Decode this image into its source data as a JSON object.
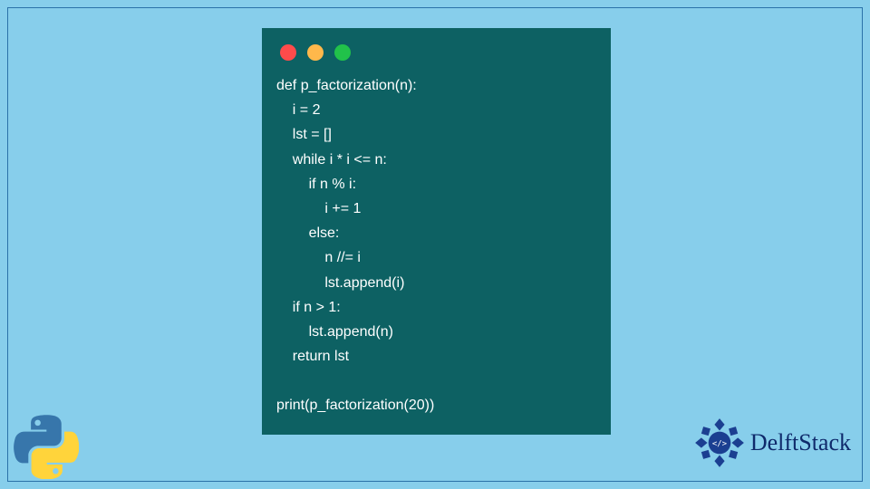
{
  "code": {
    "lines": [
      "def p_factorization(n):",
      "    i = 2",
      "    lst = []",
      "    while i * i <= n:",
      "        if n % i:",
      "            i += 1",
      "        else:",
      "            n //= i",
      "            lst.append(i)",
      "    if n > 1:",
      "        lst.append(n)",
      "    return lst",
      "",
      "print(p_factorization(20))"
    ]
  },
  "window": {
    "dots": {
      "red": "#ff4b4b",
      "yellow": "#ffb84b",
      "green": "#21c24a"
    }
  },
  "brand": {
    "name": "DelftStack"
  },
  "logos": {
    "python": "python-logo",
    "delftstack_emblem": "delftstack-emblem"
  },
  "colors": {
    "background": "#87ceeb",
    "window_bg": "#0d6163",
    "brand_color": "#0f2a6b"
  }
}
